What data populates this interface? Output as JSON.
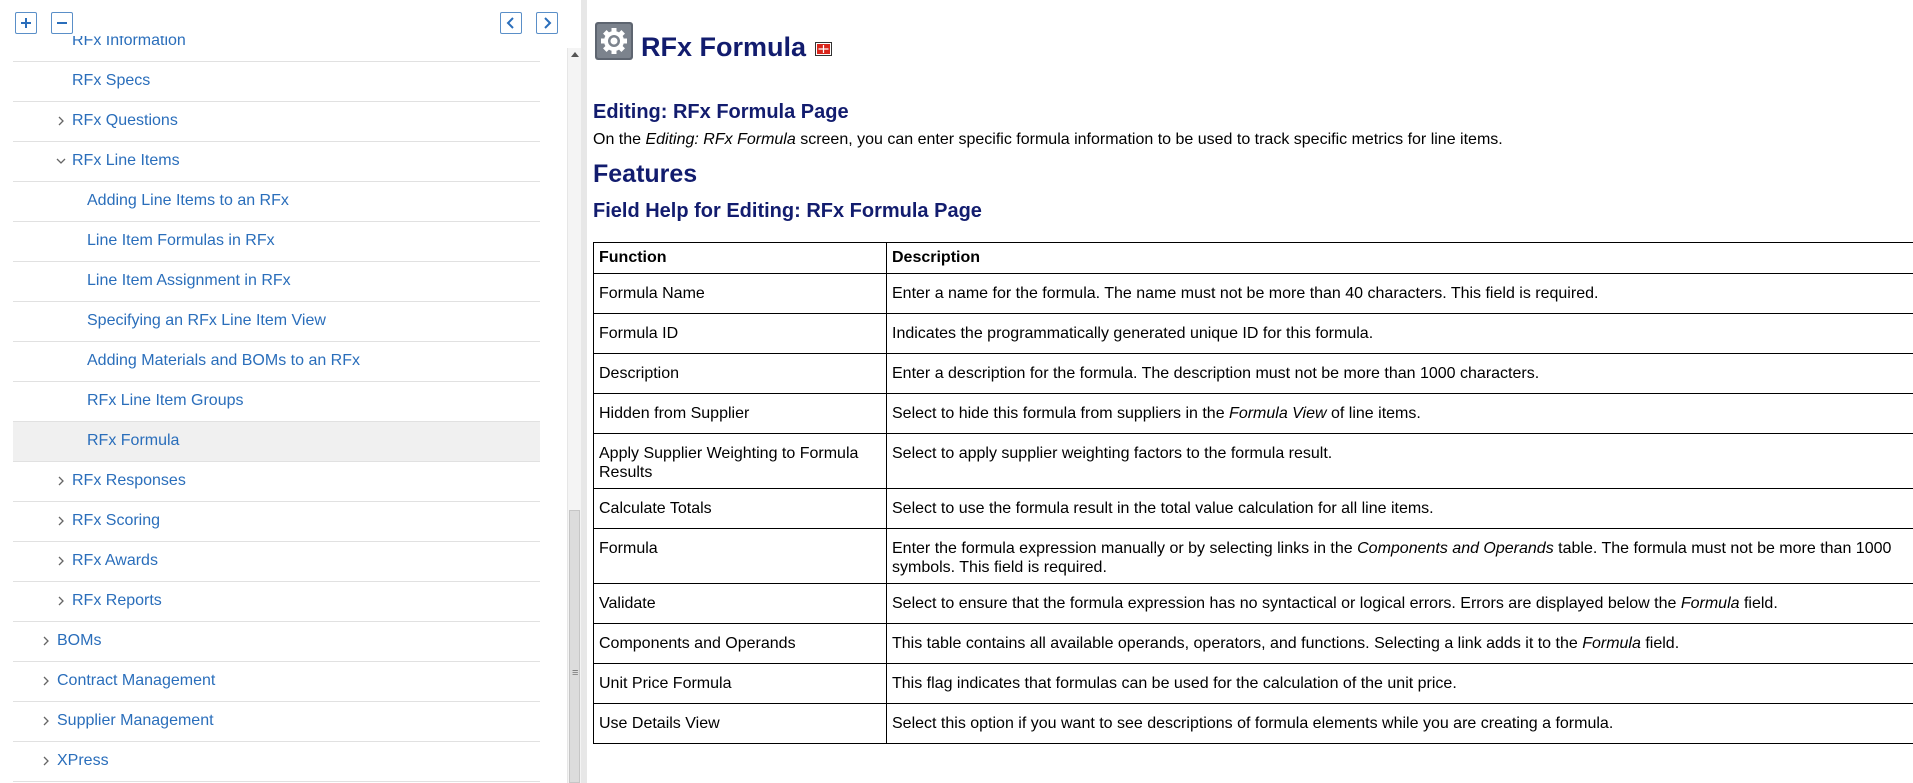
{
  "toolbar": {
    "expand_all_icon": "plus-icon",
    "collapse_all_icon": "minus-icon",
    "prev_icon": "arrow-left-icon",
    "next_icon": "arrow-right-icon"
  },
  "nav": {
    "items": [
      {
        "label": "RFx Information",
        "level": 2,
        "chevron": "none",
        "selected": false
      },
      {
        "label": "RFx Specs",
        "level": 2,
        "chevron": "none",
        "selected": false
      },
      {
        "label": "RFx Questions",
        "level": 2,
        "chevron": "right",
        "selected": false
      },
      {
        "label": "RFx Line Items",
        "level": 2,
        "chevron": "down",
        "selected": false
      },
      {
        "label": "Adding Line Items to an RFx",
        "level": 3,
        "chevron": "none",
        "selected": false
      },
      {
        "label": "Line Item Formulas in RFx",
        "level": 3,
        "chevron": "none",
        "selected": false
      },
      {
        "label": "Line Item Assignment in RFx",
        "level": 3,
        "chevron": "none",
        "selected": false
      },
      {
        "label": "Specifying an RFx Line Item View",
        "level": 3,
        "chevron": "none",
        "selected": false
      },
      {
        "label": "Adding Materials and BOMs to an RFx",
        "level": 3,
        "chevron": "none",
        "selected": false
      },
      {
        "label": "RFx Line Item Groups",
        "level": 3,
        "chevron": "none",
        "selected": false
      },
      {
        "label": "RFx Formula",
        "level": 3,
        "chevron": "none",
        "selected": true
      },
      {
        "label": "RFx Responses",
        "level": 2,
        "chevron": "right",
        "selected": false
      },
      {
        "label": "RFx Scoring",
        "level": 2,
        "chevron": "right",
        "selected": false
      },
      {
        "label": "RFx Awards",
        "level": 2,
        "chevron": "right",
        "selected": false
      },
      {
        "label": "RFx Reports",
        "level": 2,
        "chevron": "right",
        "selected": false
      },
      {
        "label": "BOMs",
        "level": 1,
        "chevron": "right",
        "selected": false
      },
      {
        "label": "Contract Management",
        "level": 1,
        "chevron": "right",
        "selected": false
      },
      {
        "label": "Supplier Management",
        "level": 1,
        "chevron": "right",
        "selected": false
      },
      {
        "label": "XPress",
        "level": 1,
        "chevron": "right",
        "selected": false
      }
    ]
  },
  "page": {
    "title": "RFx Formula",
    "title_icon": "gear-icon",
    "pdf_icon": "pdf-icon",
    "editing_heading": "Editing: RFx Formula Page",
    "intro": {
      "pre": "On the ",
      "em": "Editing: RFx Formula",
      "post": " screen, you can enter specific formula information to be used to track specific metrics for line items."
    },
    "features_heading": "Features",
    "field_help_heading": "Field Help for Editing: RFx Formula Page"
  },
  "table": {
    "headers": [
      "Function",
      "Description"
    ],
    "rows": [
      {
        "function": "Formula Name",
        "desc": [
          {
            "t": "Enter a name for the formula. The name must not be more than 40 characters. This field is required."
          }
        ]
      },
      {
        "function": "Formula ID",
        "desc": [
          {
            "t": "Indicates the programmatically generated unique ID for this formula."
          }
        ]
      },
      {
        "function": "Description",
        "desc": [
          {
            "t": "Enter a description for the formula. The description must not be more than 1000 characters."
          }
        ]
      },
      {
        "function": "Hidden from Supplier",
        "desc": [
          {
            "t": "Select to hide this formula from suppliers in the "
          },
          {
            "t": "Formula View",
            "em": true
          },
          {
            "t": " of line items."
          }
        ]
      },
      {
        "function": "Apply Supplier Weighting to Formula Results",
        "desc": [
          {
            "t": "Select to apply supplier weighting factors to the formula result."
          }
        ]
      },
      {
        "function": "Calculate Totals",
        "desc": [
          {
            "t": "Select to use the formula result in the total value calculation for all line items."
          }
        ]
      },
      {
        "function": "Formula",
        "desc": [
          {
            "t": "Enter the formula expression manually or by selecting links in the "
          },
          {
            "t": "Components and Operands",
            "em": true
          },
          {
            "t": " table. The formula must not be more than 1000 symbols. This field is required."
          }
        ]
      },
      {
        "function": "Validate",
        "desc": [
          {
            "t": "Select to ensure that the formula expression has no syntactical or logical errors. Errors are displayed below the "
          },
          {
            "t": "Formula",
            "em": true
          },
          {
            "t": " field."
          }
        ]
      },
      {
        "function": "Components and Operands",
        "desc": [
          {
            "t": "This table contains all available operands, operators, and functions. Selecting a link adds it to the "
          },
          {
            "t": "Formula",
            "em": true
          },
          {
            "t": " field."
          }
        ]
      },
      {
        "function": "Unit Price Formula",
        "desc": [
          {
            "t": "This flag indicates that formulas can be used for the calculation of the unit price."
          }
        ]
      },
      {
        "function": "Use Details View",
        "desc": [
          {
            "t": "Select this option if you want to see descriptions of formula elements while you are creating a formula."
          }
        ]
      }
    ]
  }
}
